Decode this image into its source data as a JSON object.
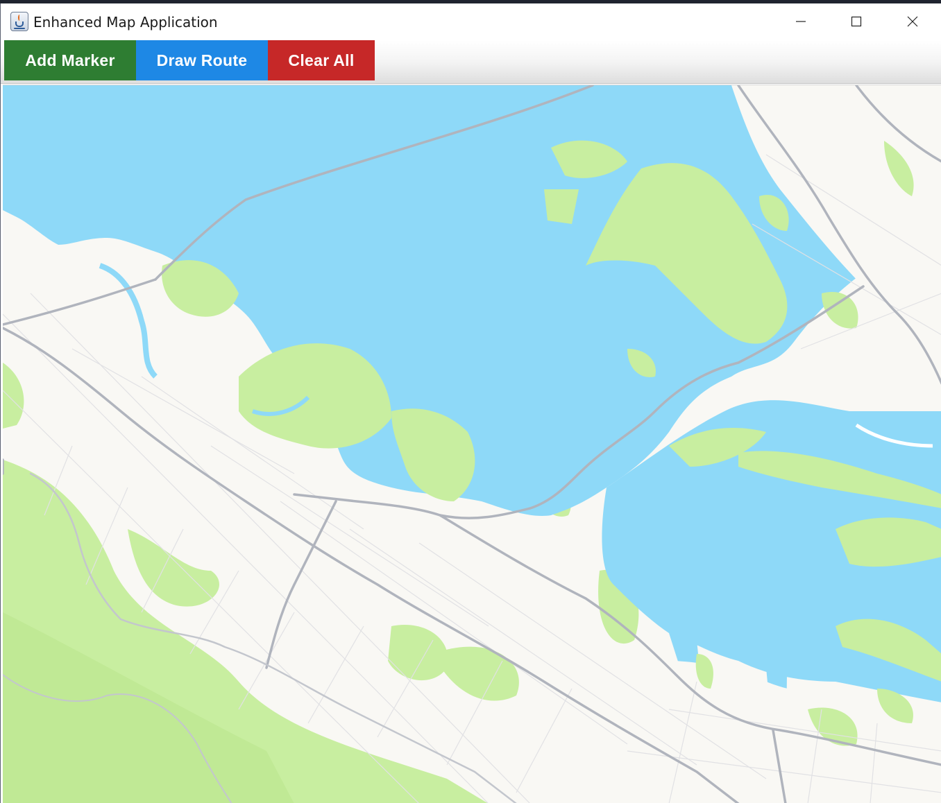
{
  "window": {
    "title": "Enhanced Map Application",
    "icon": "java-coffee-cup-icon",
    "controls": [
      "minimize-icon",
      "maximize-icon",
      "close-icon"
    ]
  },
  "toolbar": {
    "add_marker_label": "Add Marker",
    "draw_route_label": "Draw Route",
    "clear_all_label": "Clear All"
  },
  "colors": {
    "add_marker": "#2e7d32",
    "draw_route": "#1e88e5",
    "clear_all": "#c62828",
    "water": "#8ed9f8",
    "park": "#c8eea0",
    "land": "#f9f8f4",
    "road": "#b0b4bd"
  },
  "map": {
    "type": "street-map",
    "description_visible": false
  }
}
